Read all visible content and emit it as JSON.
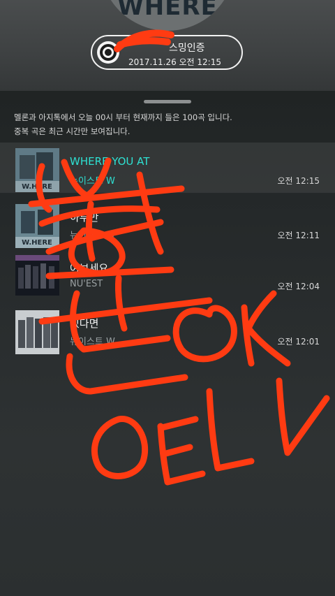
{
  "header": {
    "album_art_text": "WHERE",
    "cert_title": "스밍인증",
    "cert_time": "2017.11.26 오전 12:15"
  },
  "description": {
    "line1": "멜론과 아지톡에서 오늘 00시 부터 현재까지 들은 100곡 입니다.",
    "line2": "중복 곡은 최근 시간만 보여집니다."
  },
  "songs": [
    {
      "title": "WHERE YOU AT",
      "artist": "뉴이스트 W",
      "time": "오전 12:15",
      "art_text": "W.HERE"
    },
    {
      "title": "하루만",
      "artist": "뉴이스트 W",
      "time": "오전 12:11",
      "art_text": "W.HERE"
    },
    {
      "title": "여보세요",
      "artist": "NU'EST",
      "time": "오전 12:04",
      "art_text": ""
    },
    {
      "title": "있다면",
      "artist": "뉴이스트 W",
      "time": "오전 12:01",
      "art_text": ""
    }
  ],
  "colors": {
    "accent": "#2ee0d2",
    "doodle": "#ff3b12"
  },
  "icons": {
    "cert": "disc-icon"
  }
}
